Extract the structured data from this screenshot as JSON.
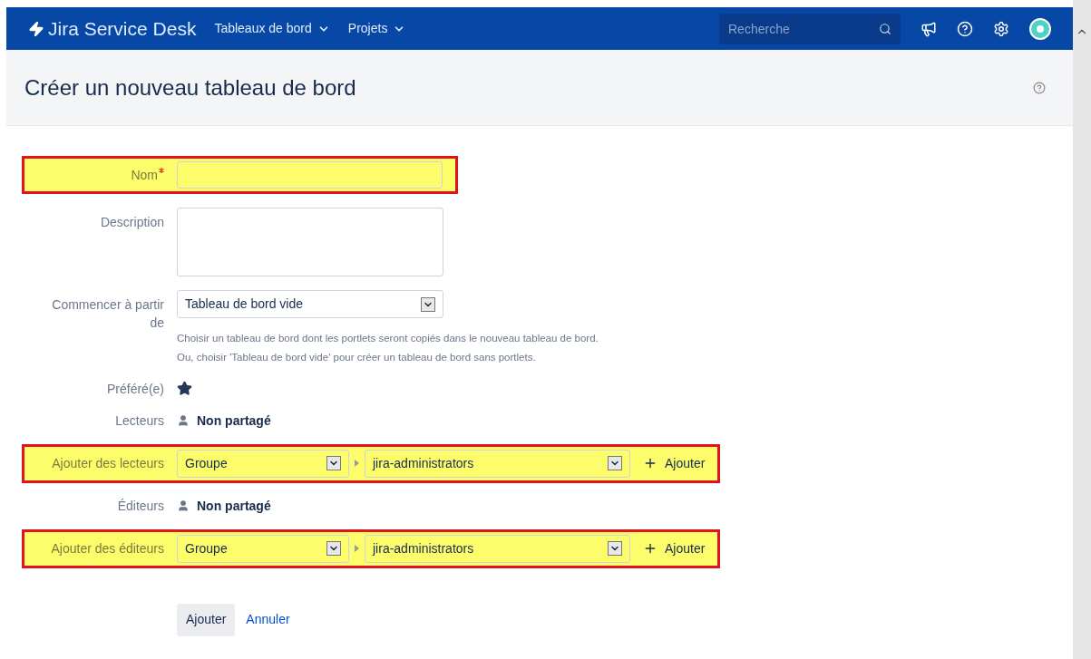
{
  "nav": {
    "product": "Jira Service Desk",
    "menus": [
      {
        "label": "Tableaux de bord"
      },
      {
        "label": "Projets"
      }
    ],
    "search": {
      "placeholder": "Recherche"
    }
  },
  "page": {
    "title": "Créer un nouveau tableau de bord"
  },
  "form": {
    "fields": [
      {
        "kind": "text",
        "label": "Nom",
        "required": true,
        "highlighted": true
      },
      {
        "kind": "textarea",
        "label": "Description",
        "highlighted": false
      },
      {
        "kind": "select",
        "label": "Commencer à partir de",
        "value": "Tableau de bord vide",
        "help": [
          "Choisir un tableau de bord dont les portlets seront copiés dans le nouveau tableau de bord.",
          "Ou, choisir 'Tableau de bord vide' pour créer un tableau de bord sans portlets."
        ],
        "highlighted": false
      },
      {
        "kind": "favourite",
        "label": "Préféré(e)",
        "starred": true,
        "highlighted": false
      },
      {
        "kind": "share",
        "label": "Lecteurs",
        "value": "Non partagé",
        "highlighted": false
      },
      {
        "kind": "add_share",
        "label": "Ajouter des lecteurs",
        "type": "Groupe",
        "group": "jira-administrators",
        "action": "Ajouter",
        "highlighted": true
      },
      {
        "kind": "share",
        "label": "Éditeurs",
        "value": "Non partagé",
        "highlighted": false
      },
      {
        "kind": "add_share",
        "label": "Ajouter des éditeurs",
        "type": "Groupe",
        "group": "jira-administrators",
        "action": "Ajouter",
        "highlighted": true
      }
    ],
    "buttons": [
      {
        "kind": "primary",
        "label": "Ajouter"
      },
      {
        "kind": "link",
        "label": "Annuler"
      }
    ]
  }
}
